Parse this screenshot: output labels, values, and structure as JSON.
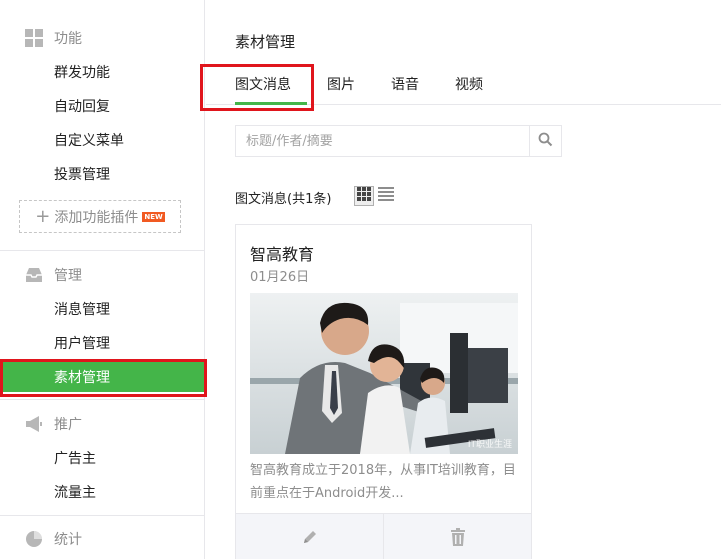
{
  "sidebar": {
    "sections": [
      {
        "title": "功能",
        "icon": "grid-icon",
        "items": [
          "群发功能",
          "自动回复",
          "自定义菜单",
          "投票管理"
        ]
      },
      {
        "title": "管理",
        "icon": "inbox-icon",
        "items": [
          "消息管理",
          "用户管理",
          "素材管理"
        ]
      },
      {
        "title": "推广",
        "icon": "megaphone-icon",
        "items": [
          "广告主",
          "流量主"
        ]
      },
      {
        "title": "统计",
        "icon": "pie-chart-icon",
        "items": []
      }
    ],
    "add_plugin_label": "添加功能插件",
    "new_badge": "NEW",
    "active_item": "素材管理"
  },
  "main": {
    "page_title": "素材管理",
    "tabs": [
      {
        "label": "图文消息",
        "active": true
      },
      {
        "label": "图片",
        "active": false
      },
      {
        "label": "语音",
        "active": false
      },
      {
        "label": "视频",
        "active": false
      }
    ],
    "search": {
      "placeholder": "标题/作者/摘要",
      "value": ""
    },
    "list_header": "图文消息(共1条)",
    "card": {
      "title": "智高教育",
      "date": "01月26日",
      "description": "智高教育成立于2018年，从事IT培训教育，目前重点在于Android开发...",
      "watermark": "IT职业生涯"
    }
  },
  "colors": {
    "accent": "#44b549",
    "highlight_box": "#e0151c"
  }
}
